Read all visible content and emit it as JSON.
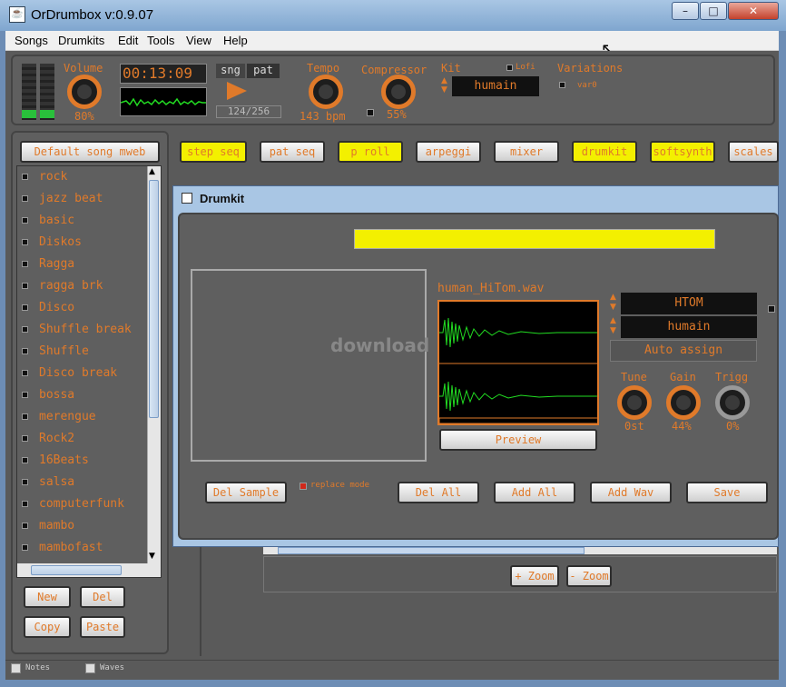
{
  "window": {
    "title": "OrDrumbox v:0.9.07",
    "buttons": [
      "–",
      "□",
      "✕"
    ]
  },
  "menu": [
    "Songs",
    "Drumkits",
    "Edit",
    "Tools",
    "View",
    "Help"
  ],
  "transport": {
    "volume_label": "Volume",
    "volume_value": "80%",
    "time": "00:13:09",
    "sng_label": "sng",
    "pat_label": "pat",
    "position": "124/256",
    "tempo_label": "Tempo",
    "tempo_value": "143 bpm",
    "compressor_label": "Compressor",
    "compressor_value": "55%",
    "kit_label": "Kit",
    "kit_value": "humain",
    "lofi_label": "Lofi",
    "variations_label": "Variations",
    "var_value": "var0"
  },
  "song_list": {
    "title_button": "Default song mweb",
    "songs": [
      "rock",
      "jazz beat",
      "basic",
      "Diskos",
      "Ragga",
      "ragga brk",
      "Disco",
      "Shuffle break",
      "Shuffle",
      "Disco break",
      "bossa",
      "merengue",
      "Rock2",
      "16Beats",
      "salsa",
      "computerfunk",
      "mambo",
      "mambofast"
    ],
    "buttons": {
      "new": "New",
      "del": "Del",
      "copy": "Copy",
      "paste": "Paste"
    }
  },
  "view_tabs": [
    "step seq",
    "pat seq",
    "p roll",
    "arpeggi",
    "mixer",
    "drumkit",
    "softsynth",
    "scales"
  ],
  "drumkit": {
    "title": "Drumkit",
    "wav_name": "human_HiTom.wav",
    "instrument": "HTOM",
    "kit": "humain",
    "auto_assign": "Auto assign",
    "preview": "Preview",
    "tune_label": "Tune",
    "tune_value": "0st",
    "gain_label": "Gain",
    "gain_value": "44%",
    "trigg_label": "Trigg",
    "trigg_value": "0%",
    "replace_mode": "replace mode",
    "buttons": {
      "del_sample": "Del Sample",
      "del_all": "Del All",
      "add_all": "Add All",
      "add_wav": "Add Wav",
      "save": "Save"
    },
    "watermark": "download"
  },
  "zoom": {
    "plus": "+ Zoom",
    "minus": "- Zoom"
  },
  "status": {
    "notes": "Notes",
    "waves": "Waves"
  }
}
